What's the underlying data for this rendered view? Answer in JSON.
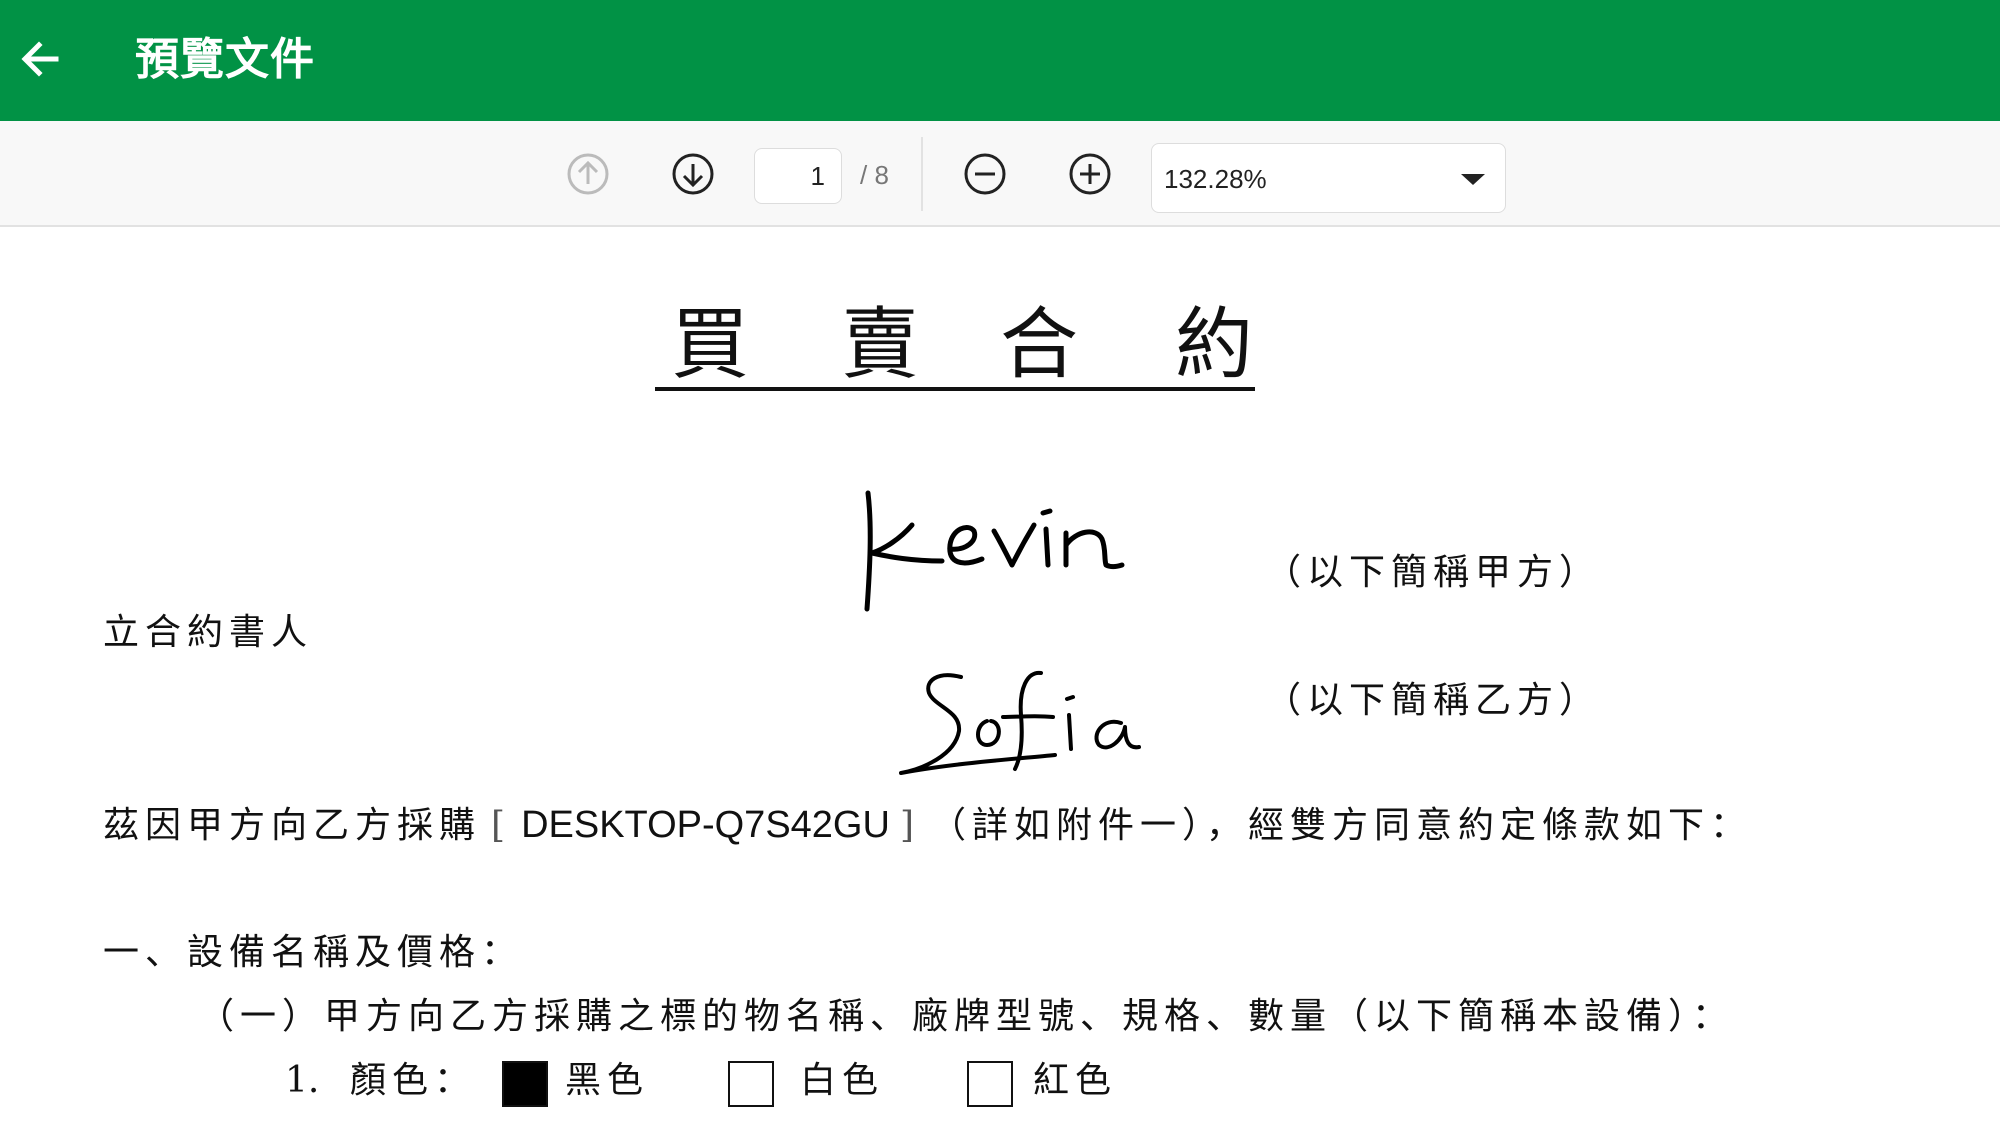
{
  "appbar": {
    "title": "預覽文件",
    "background": "#019245"
  },
  "toolbar": {
    "prev_page_icon": "arrow-up-circle-icon",
    "next_page_icon": "arrow-down-circle-icon",
    "page_current": "1",
    "page_total": "/ 8",
    "zoom_out_icon": "minus-circle-icon",
    "zoom_in_icon": "plus-circle-icon",
    "zoom_value": "132.28%"
  },
  "document": {
    "title_chars": [
      "買",
      "賣",
      "合",
      "約"
    ],
    "party_label": "立合約書人",
    "party_a_suffix": "（以下簡稱甲方）",
    "party_b_suffix": "（以下簡稱乙方）",
    "signature_a": "Kevin",
    "signature_b": "Sofia",
    "intro_prefix": "茲因甲方向乙方採購",
    "intro_bracket_open": "[",
    "intro_product": "DESKTOP-Q7S42GU",
    "intro_bracket_close": "]",
    "intro_suffix": "（詳如附件一），經雙方同意約定條款如下：",
    "section1_title": "一、設備名稱及價格：",
    "section1_item1": "（一）甲方向乙方採購之標的物名稱、廠牌型號、規格、數量（以下簡稱本設備）：",
    "color_row": {
      "number": "1.",
      "label": "顏色：",
      "options": [
        {
          "label": "黑色",
          "checked": true
        },
        {
          "label": "白色",
          "checked": false
        },
        {
          "label": "紅色",
          "checked": false
        }
      ]
    }
  }
}
